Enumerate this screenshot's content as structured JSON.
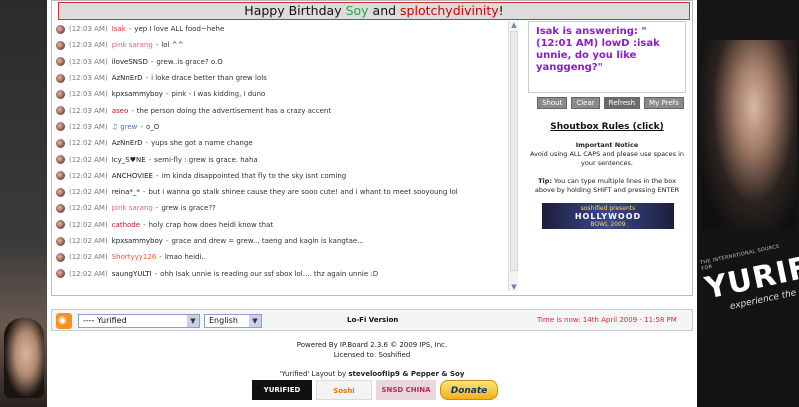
{
  "banner": {
    "prefix": "Happy Birthday ",
    "name1": "Soy",
    "mid": " and ",
    "name2": "splotchydivinity",
    "suffix": "!"
  },
  "chat": [
    {
      "time": "(12:03 AM)",
      "nick": "Isak",
      "nick_color": "#d23c3c",
      "msg": "yep I love ALL food~hehe"
    },
    {
      "time": "(12:03 AM)",
      "nick": "pink sarang",
      "nick_color": "#e05aa0",
      "msg": "lol ^^"
    },
    {
      "time": "(12:03 AM)",
      "nick": "iloveSNSD",
      "nick_color": "#222222",
      "msg": "grew..is grace? o.O"
    },
    {
      "time": "(12:03 AM)",
      "nick": "AzNnErD",
      "nick_color": "#222222",
      "msg": "i loke drace better than grew lols"
    },
    {
      "time": "(12:03 AM)",
      "nick": "kpxsammyboy",
      "nick_color": "#222222",
      "msg": "pink - i was kidding, i duno"
    },
    {
      "time": "(12:03 AM)",
      "nick": "aseo",
      "nick_color": "#c0182b",
      "msg": "the person doing the advertisement has a crazy accent"
    },
    {
      "time": "(12:03 AM)",
      "nick": "♫ grew",
      "nick_color": "#4b6fc7",
      "msg": "o_O"
    },
    {
      "time": "(12:02 AM)",
      "nick": "AzNnErD",
      "nick_color": "#222222",
      "msg": "yups she got a name change"
    },
    {
      "time": "(12:02 AM)",
      "nick": "Icy_S♥NE",
      "nick_color": "#222222",
      "msg": "semi-fly : grew is grace. haha"
    },
    {
      "time": "(12:02 AM)",
      "nick": "ANCHOVIEE",
      "nick_color": "#222222",
      "msg": "im kinda disappointed that fly to the sky isnt coming"
    },
    {
      "time": "(12:02 AM)",
      "nick": "reina*_*",
      "nick_color": "#222222",
      "msg": "but i wanna go stalk shinee cause they are sooo cute! and i whant to meet sooyoung lol"
    },
    {
      "time": "(12:02 AM)",
      "nick": "pink sarang",
      "nick_color": "#e05aa0",
      "msg": "grew is grace??"
    },
    {
      "time": "(12:02 AM)",
      "nick": "cathode",
      "nick_color": "#c0182b",
      "msg": "holy crap how does heidi know that"
    },
    {
      "time": "(12:02 AM)",
      "nick": "kpxsammyboy",
      "nick_color": "#222222",
      "msg": "grace and drew = grew... taeng and kagin is kangtae..."
    },
    {
      "time": "(12:02 AM)",
      "nick": "Shortyyy126",
      "nick_color": "#e05a2a",
      "msg": "lmao heidi.."
    },
    {
      "time": "(12:02 AM)",
      "nick": "saungYULTI",
      "nick_color": "#222222",
      "msg": "ohh Isak unnie is reading our ssf sbox lol.... thz again unnie :D"
    }
  ],
  "status_text": "Isak is answering: \"(12:01 AM) lowD :isak unnie, do you like yanggeng?\"",
  "buttons": {
    "shout": "Shout",
    "clear": "Clear",
    "refresh": "Refresh",
    "prefs": "My Prefs"
  },
  "rules": {
    "title": "Shoutbox Rules (click)",
    "notice_title": "Important Notice",
    "notice_body": "Avoid using ALL CAPS and please use spaces in your sentences.",
    "tip_label": "Tip:",
    "tip_body": " You can type multiple lines in the box above by holding SHIFT and pressing ENTER"
  },
  "ad": {
    "line1": "soshified presents",
    "line2": "HOLLYWOOD",
    "line3": "BOWL 2009"
  },
  "bottom": {
    "skin_select": "---- Yurified",
    "lang_select": "English",
    "lofi": "Lo-Fi Version",
    "time_now": "Time is now: 14th April 2009 - 11:58 PM"
  },
  "footer": {
    "powered": "Powered By IP.Board 2.3.6 © 2009  IPS, Inc.",
    "licensed": "Licensed to: Soshified",
    "layout_prefix": "'Yurified' Layout by ",
    "layout_authors": "steveloofIip9 & Pepper & Soy"
  },
  "badges": {
    "b1": "YURIFIED",
    "b2": "Soshi",
    "b3": "SNSD CHINA",
    "b4": "Donate"
  },
  "side": {
    "brand_small": "THE INTERNATIONAL SOURCE FOR",
    "brand_big": "YURIFI",
    "brand_tag": "experience the"
  }
}
